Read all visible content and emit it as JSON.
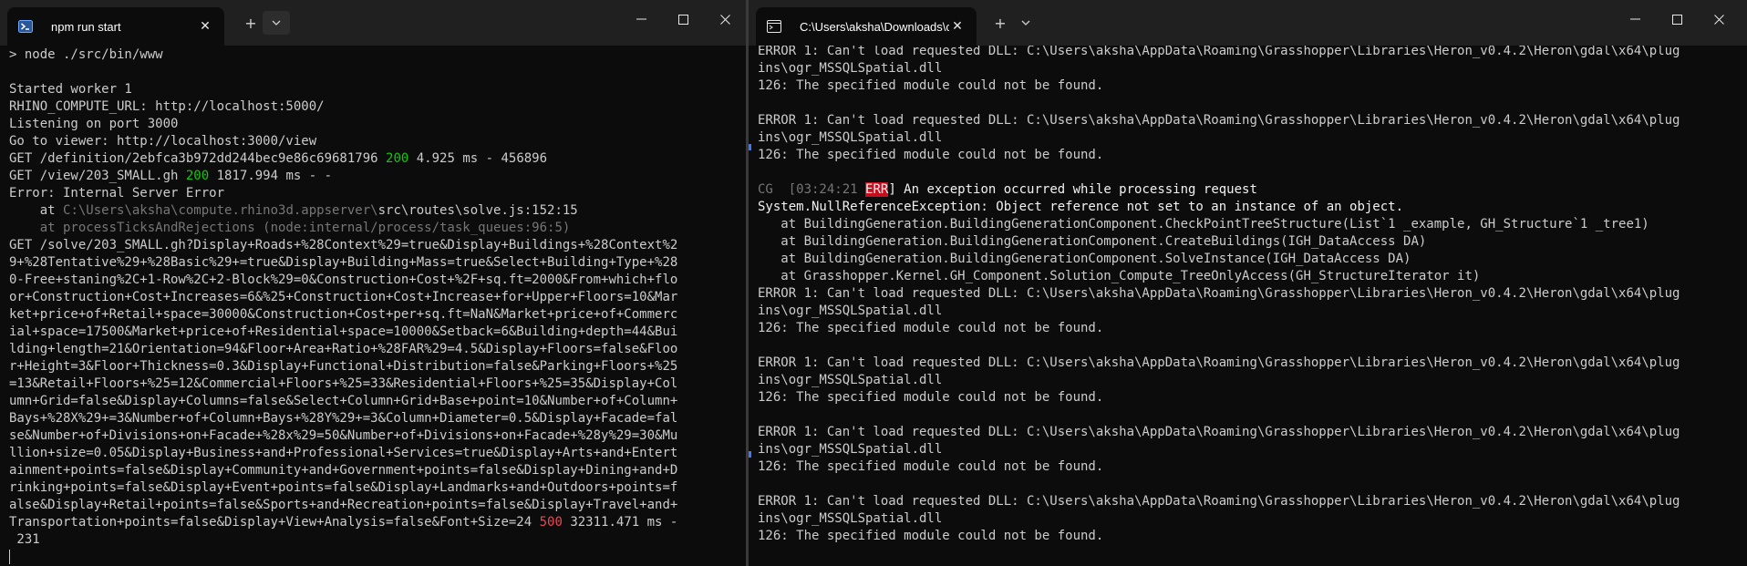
{
  "colors": {
    "accent_green": "#16c60c",
    "error_red": "#e74856",
    "err_badge": "#c50f1f",
    "text": "#cccccc",
    "background": "#0c0c0c",
    "titlebar": "#202020"
  },
  "left_window": {
    "tab_title": "npm run start",
    "tab_icon": "powershell-icon",
    "lines": {
      "l0": "> node ./src/bin/www",
      "l1": "",
      "l2": "Started worker 1",
      "l3": "RHINO_COMPUTE_URL: http://localhost:5000/",
      "l4": "Listening on port 3000",
      "l5": "Go to viewer: http://localhost:3000/view",
      "l6a": "GET /definition/2ebfca3b972dd244bec9e86c69681796 ",
      "l6b": "200",
      "l6c": " 4.925 ms - 456896",
      "l7a": "GET /view/203_SMALL.gh ",
      "l7b": "200",
      "l7c": " 1817.994 ms - -",
      "l8": "Error: Internal Server Error",
      "l9a": "    at ",
      "l9b": "C:\\Users\\aksha\\compute.rhino3d.appserver\\",
      "l9c": "src\\routes\\solve.js:152:15",
      "l10": "    at processTicksAndRejections (node:internal/process/task_queues:96:5)",
      "l11": "GET /solve/203_SMALL.gh?Display+Roads+%28Context%29=true&Display+Buildings+%28Context%2",
      "l12": "9+%28Tentative%29+%28Basic%29+=true&Display+Building+Mass=true&Select+Building+Type+%28",
      "l13": "0-Free+staning%2C+1-Row%2C+2-Block%29=0&Construction+Cost+%2F+sq.ft=2000&From+which+flo",
      "l14": "or+Construction+Cost+Increases=6&%25+Construction+Cost+Increase+for+Upper+Floors=10&Mar",
      "l15": "ket+price+of+Retail+space=30000&Construction+Cost+per+sq.ft=NaN&Market+price+of+Commerc",
      "l16": "ial+space=17500&Market+price+of+Residential+space=10000&Setback=6&Building+depth=44&Bui",
      "l17": "lding+length=21&Orientation=94&Floor+Area+Ratio+%28FAR%29=4.5&Display+Floors=false&Floo",
      "l18": "r+Height=3&Floor+Thickness=0.3&Display+Functional+Distribution=false&Parking+Floors+%25",
      "l19": "=13&Retail+Floors+%25=12&Commercial+Floors+%25=33&Residential+Floors+%25=35&Display+Col",
      "l20": "umn+Grid=false&Display+Columns=false&Select+Column+Grid+Base+point=10&Number+of+Column+",
      "l21": "Bays+%28X%29+=3&Number+of+Column+Bays+%28Y%29+=3&Column+Diameter=0.5&Display+Facade=fal",
      "l22": "se&Number+of+Divisions+on+Facade+%28x%29=50&Number+of+Divisions+on+Facade+%28y%29=30&Mu",
      "l23": "llion+size=0.05&Display+Business+and+Professional+Services=true&Display+Arts+and+Entert",
      "l24": "ainment+points=false&Display+Community+and+Government+points=false&Display+Dining+and+D",
      "l25": "rinking+points=false&Display+Event+points=false&Display+Landmarks+and+Outdoors+points=f",
      "l26": "alse&Display+Retail+points=false&Sports+and+Recreation+points=false&Display+Travel+and+",
      "l27a": "Transportation+points=false&Display+View+Analysis=false&Font+Size=24 ",
      "l27b": "500",
      "l27c": " 32311.471 ms -",
      "l28": " 231"
    }
  },
  "right_window": {
    "tab_title": "C:\\Users\\aksha\\Downloads\\cc",
    "tab_icon": "console-icon",
    "lines": {
      "r0": "ERROR 1: Can't load requested DLL: C:\\Users\\aksha\\AppData\\Roaming\\Grasshopper\\Libraries\\Heron_v0.4.2\\Heron\\gdal\\x64\\plug",
      "r1": "ins\\ogr_MSSQLSpatial.dll",
      "r2": "126: The specified module could not be found.",
      "r3": "",
      "r4": "ERROR 1: Can't load requested DLL: C:\\Users\\aksha\\AppData\\Roaming\\Grasshopper\\Libraries\\Heron_v0.4.2\\Heron\\gdal\\x64\\plug",
      "r5": "ins\\ogr_MSSQLSpatial.dll",
      "r6": "126: The specified module could not be found.",
      "r7": "",
      "r8a": "CG  [03:24:21 ",
      "r8b": "ERR",
      "r8c": "] An exception occurred while processing request",
      "r9": "System.NullReferenceException: Object reference not set to an instance of an object.",
      "r10": "   at BuildingGeneration.BuildingGenerationComponent.CheckPointTreeStructure(List`1 _example, GH_Structure`1 _tree1)",
      "r11": "   at BuildingGeneration.BuildingGenerationComponent.CreateBuildings(IGH_DataAccess DA)",
      "r12": "   at BuildingGeneration.BuildingGenerationComponent.SolveInstance(IGH_DataAccess DA)",
      "r13": "   at Grasshopper.Kernel.GH_Component.Solution_Compute_TreeOnlyAccess(GH_StructureIterator it)",
      "r14": "ERROR 1: Can't load requested DLL: C:\\Users\\aksha\\AppData\\Roaming\\Grasshopper\\Libraries\\Heron_v0.4.2\\Heron\\gdal\\x64\\plug",
      "r15": "ins\\ogr_MSSQLSpatial.dll",
      "r16": "126: The specified module could not be found.",
      "r17": "",
      "r18": "ERROR 1: Can't load requested DLL: C:\\Users\\aksha\\AppData\\Roaming\\Grasshopper\\Libraries\\Heron_v0.4.2\\Heron\\gdal\\x64\\plug",
      "r19": "ins\\ogr_MSSQLSpatial.dll",
      "r20": "126: The specified module could not be found.",
      "r21": "",
      "r22": "ERROR 1: Can't load requested DLL: C:\\Users\\aksha\\AppData\\Roaming\\Grasshopper\\Libraries\\Heron_v0.4.2\\Heron\\gdal\\x64\\plug",
      "r23": "ins\\ogr_MSSQLSpatial.dll",
      "r24": "126: The specified module could not be found.",
      "r25": "",
      "r26": "ERROR 1: Can't load requested DLL: C:\\Users\\aksha\\AppData\\Roaming\\Grasshopper\\Libraries\\Heron_v0.4.2\\Heron\\gdal\\x64\\plug",
      "r27": "ins\\ogr_MSSQLSpatial.dll",
      "r28": "126: The specified module could not be found."
    }
  },
  "icons": {
    "close": "close-icon",
    "new_tab": "plus-icon",
    "dropdown": "chevron-down-icon",
    "minimize": "minimize-icon",
    "maximize": "maximize-icon"
  }
}
